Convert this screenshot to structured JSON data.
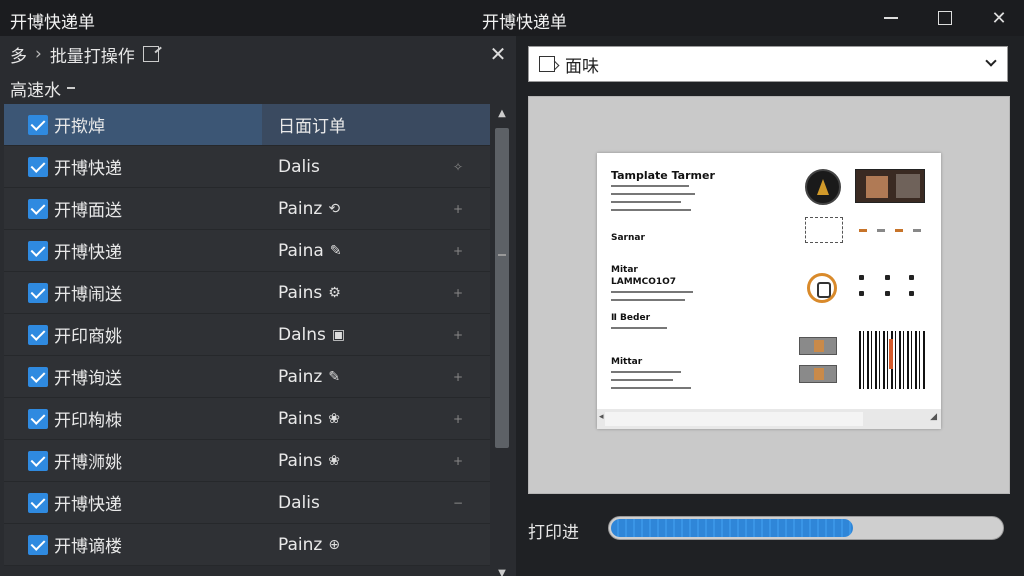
{
  "window": {
    "title": "开博快递单",
    "center_title": "开博快递单"
  },
  "left_panel": {
    "breadcrumb_root": "多",
    "breadcrumb_sep": "›",
    "breadcrumb_current": "批量打操作",
    "section_label": "高速水",
    "rows": [
      {
        "name": "开揿焯",
        "value": "日面订单",
        "checked": true,
        "selected": true,
        "icon": ""
      },
      {
        "name": "开博快递",
        "value": "Dalis",
        "checked": true,
        "icon": "✧"
      },
      {
        "name": "开博面送",
        "value": "Painz",
        "checked": true,
        "icon": "⟲"
      },
      {
        "name": "开博快递",
        "value": "Paina",
        "checked": true,
        "icon": "✎"
      },
      {
        "name": "开博闹送",
        "value": "Pains",
        "checked": true,
        "icon": "⚙"
      },
      {
        "name": "开印商姚",
        "value": "Dalns",
        "checked": true,
        "icon": "▣"
      },
      {
        "name": "开博询送",
        "value": "Painz",
        "checked": true,
        "icon": "✎"
      },
      {
        "name": "开印栒栜",
        "value": "Pains",
        "checked": true,
        "icon": "❀"
      },
      {
        "name": "开博浉姚",
        "value": "Pains",
        "checked": true,
        "icon": "❀"
      },
      {
        "name": "开博快递",
        "value": "Dalis",
        "checked": true,
        "icon": ""
      },
      {
        "name": "开博谪楼",
        "value": "Painz",
        "checked": true,
        "icon": "⊕"
      }
    ],
    "row_markers": [
      "",
      "✧",
      "+",
      "+",
      "+",
      "+",
      "+",
      "+",
      "+",
      "−",
      ""
    ]
  },
  "right_panel": {
    "template_select_value": "面味",
    "document": {
      "title": "Tamplate Tarmer",
      "heading_1": "Sarnar",
      "heading_2": "Mitar",
      "heading_2_sub": "LAMMCO1O7",
      "heading_3": "Ⅱ Beder",
      "heading_4": "Mittar"
    },
    "progress_label": "打印进",
    "progress_value": 0.62
  }
}
